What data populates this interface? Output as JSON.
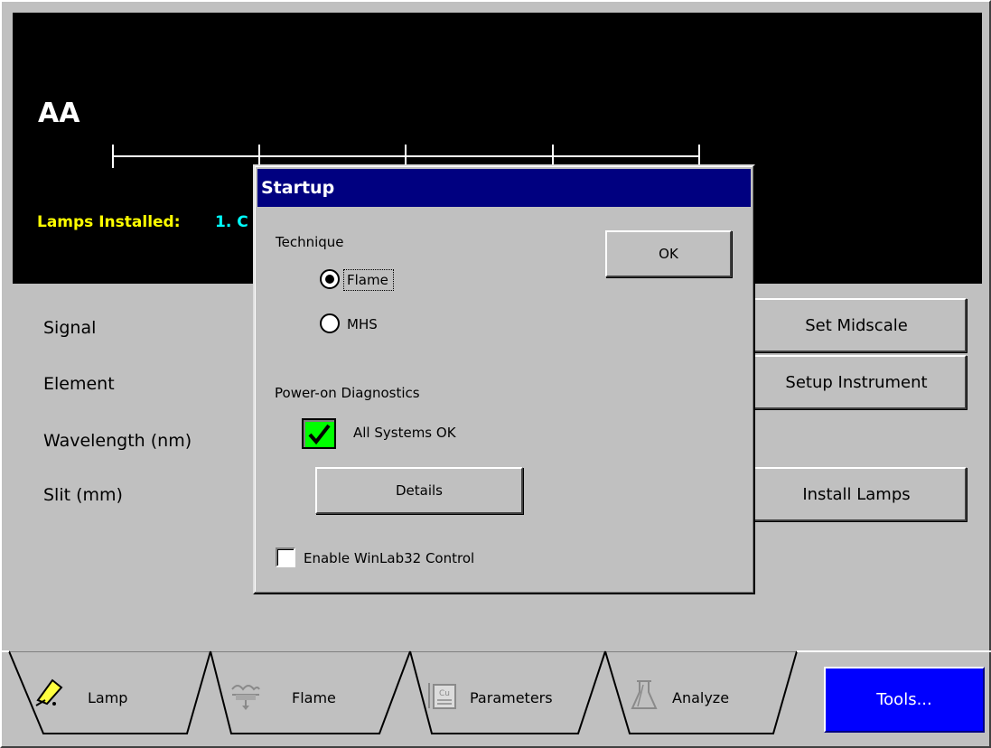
{
  "display": {
    "technique_title": "AA",
    "lamps_installed_label": "Lamps Installed:",
    "lamps_installed_value": "1. C"
  },
  "fields": {
    "signal_label": "Signal",
    "element_label": "Element",
    "wavelength_label": "Wavelength (nm)",
    "slit_label": "Slit (mm)"
  },
  "buttons": {
    "set_midscale": "Set Midscale",
    "setup_instrument": "Setup Instrument",
    "install_lamps": "Install Lamps",
    "tools": "Tools..."
  },
  "tabs": [
    {
      "label": "Lamp",
      "icon": "lamp-icon"
    },
    {
      "label": "Flame",
      "icon": "flame-icon"
    },
    {
      "label": "Parameters",
      "icon": "parameters-icon"
    },
    {
      "label": "Analyze",
      "icon": "analyze-icon"
    }
  ],
  "dialog": {
    "title": "Startup",
    "technique_label": "Technique",
    "options": [
      {
        "label": "Flame",
        "selected": true
      },
      {
        "label": "MHS",
        "selected": false
      }
    ],
    "ok_label": "OK",
    "diagnostics_label": "Power-on Diagnostics",
    "diagnostics_status": "All Systems OK",
    "details_label": "Details",
    "winlab_label": "Enable WinLab32 Control",
    "winlab_checked": false
  },
  "colors": {
    "title_bar": "#000080",
    "lamps_label": "#ffff00",
    "lamps_value": "#00ffff",
    "tools_button": "#0000ff",
    "diagnostic_ok": "#00ff00"
  }
}
